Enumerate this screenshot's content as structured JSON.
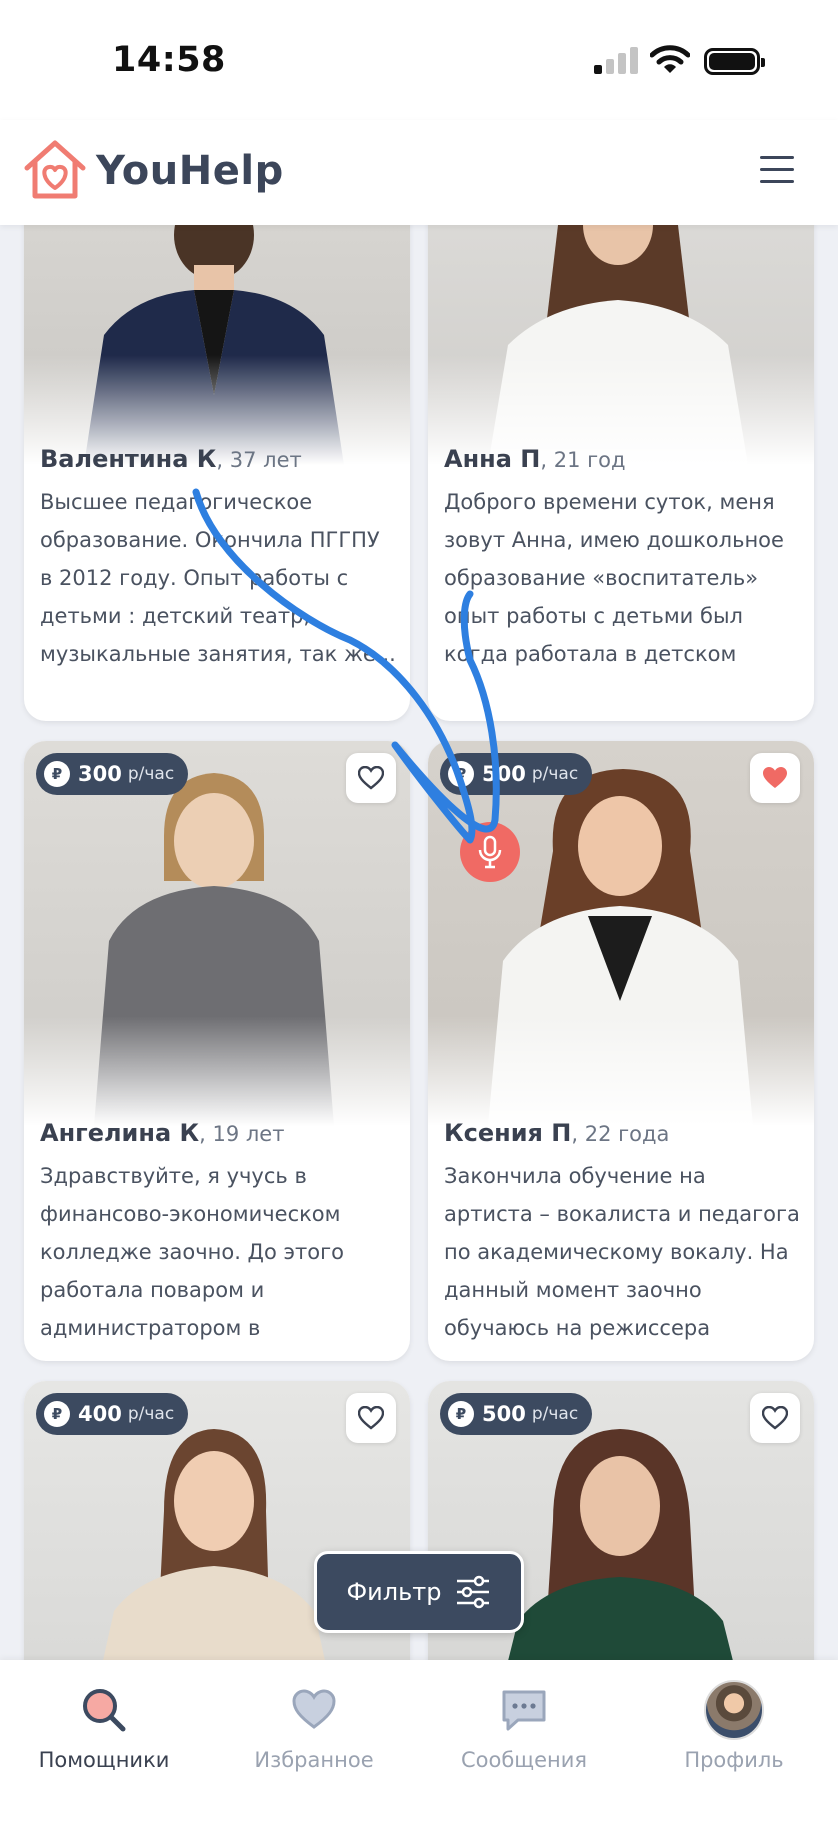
{
  "status_bar": {
    "time": "14:58"
  },
  "app": {
    "name": "YouHelp"
  },
  "colors": {
    "accent": "#f06a64",
    "dark": "#3c4a60",
    "text": "#3a4150"
  },
  "cards": [
    {
      "name": "Валентина К",
      "age": ", 37 лет",
      "price": "",
      "price_unit": "",
      "favorite": false,
      "description": "Высшее педагогическое образование. Окончила ПГГПУ в 2012 году. Опыт работы с детьми : детский театр, музыкальные занятия, так же..."
    },
    {
      "name": "Анна П",
      "age": ", 21 год",
      "price": "",
      "price_unit": "",
      "favorite": false,
      "description": "Доброго времени суток, меня зовут Анна, имею дошкольное образование «воспитатель» опыт работы с детьми был когда работала в детском сад..."
    },
    {
      "name": "Ангелина К",
      "age": ", 19 лет",
      "price": "300",
      "price_unit": "р/час",
      "favorite": false,
      "description": "Здравствуйте, я учусь в финансово-экономическом колледже заочно. До этого работала поваром и администратором в общепите,..."
    },
    {
      "name": "Ксения П",
      "age": ", 22 года",
      "price": "500",
      "price_unit": "р/час",
      "favorite": true,
      "description": "Закончила обучение на артиста – вокалиста и педагога по академическому вокалу. На данный момент заочно обучаюсь на режиссера театр..."
    },
    {
      "name": "",
      "age": "",
      "price": "400",
      "price_unit": "р/час",
      "favorite": false,
      "description": ""
    },
    {
      "name": "",
      "age": "",
      "price": "500",
      "price_unit": "р/час",
      "favorite": false,
      "description": ""
    }
  ],
  "currency_symbol": "₽",
  "filter": {
    "label": "Фильтр"
  },
  "nav": [
    {
      "label": "Помощники",
      "icon": "search-icon",
      "active": true
    },
    {
      "label": "Избранное",
      "icon": "heart-icon",
      "active": false
    },
    {
      "label": "Сообщения",
      "icon": "chat-icon",
      "active": false
    },
    {
      "label": "Профиль",
      "icon": "avatar",
      "active": false
    }
  ]
}
